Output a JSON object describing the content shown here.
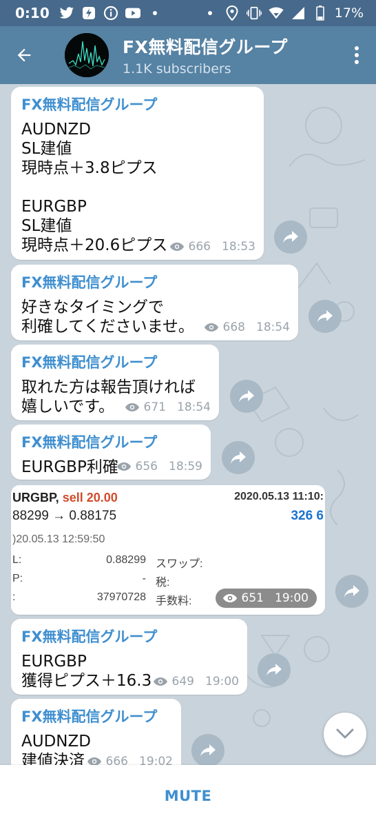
{
  "statusbar": {
    "time": "0:10",
    "battery": "17%",
    "icons": [
      "twitter-icon",
      "flash-app-icon",
      "info-icon",
      "youtube-icon",
      "dot",
      "dot",
      "location-icon",
      "vibrate-icon",
      "wifi-icon",
      "signal-icon",
      "battery-icon"
    ]
  },
  "header": {
    "back_icon": "arrow-left-icon",
    "title": "FX無料配信グループ",
    "subtitle": "1.1K subscribers",
    "menu_icon": "more-vertical-icon"
  },
  "colors": {
    "statusbar": "#47698b",
    "appbar": "#5682a3",
    "chat_bg": "#c9d3db",
    "author": "#3f8fd0",
    "meta": "#9aa3ab",
    "share_btn": "#a9b9c6",
    "trade_sell": "#d24b2b",
    "trade_profit": "#1a73d0"
  },
  "messages": [
    {
      "author": "FX無料配信グループ",
      "text": "AUDNZD\nSL建値\n現時点＋3.8ピプス\n\nEURGBP\nSL建値\n現時点＋20.6ピプス",
      "views": "666",
      "time": "18:53"
    },
    {
      "author": "FX無料配信グループ",
      "text": "好きなタイミングで\n利確してくださいませ。",
      "views": "668",
      "time": "18:54"
    },
    {
      "author": "FX無料配信グループ",
      "text": "取れた方は報告頂ければ\n嬉しいです。",
      "views": "671",
      "time": "18:54"
    },
    {
      "author": "FX無料配信グループ",
      "text": "EURGBP利確",
      "views": "656",
      "time": "18:59"
    },
    {
      "author": "FX無料配信グループ",
      "text": "EURGBP\n獲得ピプス＋16.3",
      "views": "649",
      "time": "19:00"
    },
    {
      "author": "FX無料配信グループ",
      "text": "AUDNZD\n建値決済",
      "views": "666",
      "time": "19:02"
    }
  ],
  "image_message": {
    "pair": "URGBP,",
    "side": "sell 20.00",
    "date": "2020.05.13 11:10:",
    "prices": "88299 → 0.88175",
    "profit": "326 6",
    "open_time": ")20.05.13 12:59:50",
    "rows": [
      {
        "label": "L:",
        "value": "0.88299",
        "label2": "スワップ:"
      },
      {
        "label": "P:",
        "value": "-",
        "label2": "税:"
      },
      {
        "label": ":",
        "value": "37970728",
        "label2": "手数料:"
      }
    ],
    "views": "651",
    "time": "19:00"
  },
  "share_icon": "share-arrow-icon",
  "scroll_icon": "chevron-down-icon",
  "bottom": {
    "mute_label": "MUTE"
  }
}
